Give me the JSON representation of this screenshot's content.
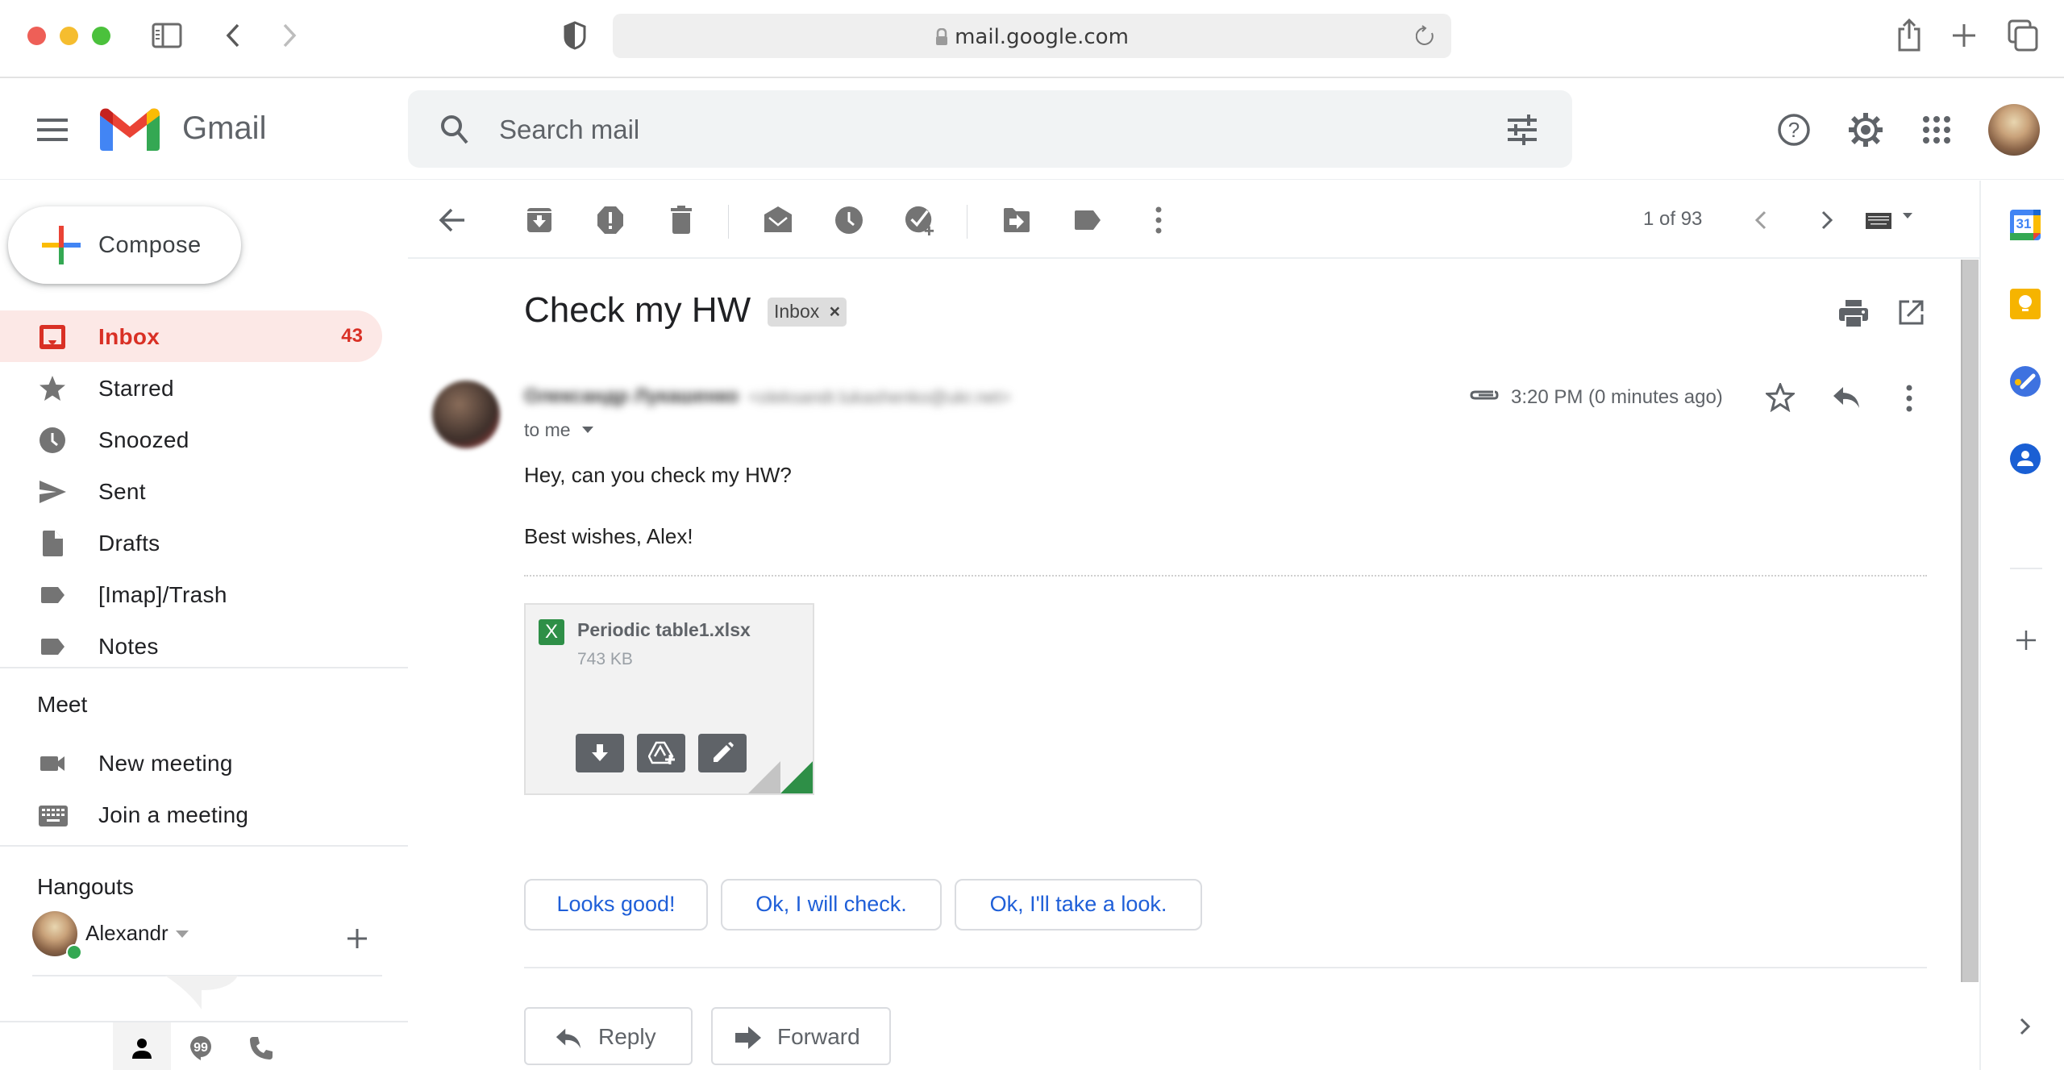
{
  "browser": {
    "url": "mail.google.com",
    "icons": [
      "sidebar-toggle-icon",
      "back-icon",
      "forward-icon",
      "privacy-shield-icon",
      "lock-icon",
      "reload-icon",
      "share-icon",
      "new-tab-icon",
      "tab-overview-icon"
    ]
  },
  "header": {
    "app_name": "Gmail",
    "search_placeholder": "Search mail",
    "icons": [
      "main-menu-icon",
      "search-icon",
      "search-options-icon",
      "help-icon",
      "settings-icon",
      "apps-grid-icon",
      "account-avatar"
    ]
  },
  "sidebar": {
    "compose_label": "Compose",
    "items": [
      {
        "label": "Inbox",
        "count": "43",
        "icon": "inbox-icon",
        "active": true
      },
      {
        "label": "Starred",
        "icon": "star-icon"
      },
      {
        "label": "Snoozed",
        "icon": "clock-icon"
      },
      {
        "label": "Sent",
        "icon": "send-icon"
      },
      {
        "label": "Drafts",
        "icon": "draft-icon"
      },
      {
        "label": "[Imap]/Trash",
        "icon": "label-icon"
      },
      {
        "label": "Notes",
        "icon": "label-icon"
      }
    ],
    "meet": {
      "title": "Meet",
      "items": [
        {
          "label": "New meeting",
          "icon": "video-camera-icon"
        },
        {
          "label": "Join a meeting",
          "icon": "keyboard-icon"
        }
      ]
    },
    "hangouts": {
      "title": "Hangouts",
      "user_name": "Alexandr",
      "status_color": "#34a853",
      "tabs": [
        "contacts-icon",
        "hangouts-chat-icon",
        "phone-icon"
      ]
    }
  },
  "toolbar": {
    "pager": "1 of 93",
    "icons": [
      "back-arrow-icon",
      "archive-icon",
      "report-spam-icon",
      "delete-icon",
      "mark-unread-icon",
      "snooze-icon",
      "add-to-tasks-icon",
      "move-to-icon",
      "labels-icon",
      "more-icon",
      "newer-icon",
      "older-icon",
      "input-tools-icon"
    ]
  },
  "email": {
    "subject": "Check my HW",
    "label_chip": "Inbox",
    "sender_name": "Олександр Лукашенко",
    "sender_email": "<oleksandr.lukashenko@ukr.net>",
    "to": "to me",
    "timestamp": "3:20 PM (0 minutes ago)",
    "body": [
      "Hey, can you check my HW?",
      "Best wishes, Alex!"
    ],
    "attachment": {
      "name": "Periodic table1.xlsx",
      "size": "743 KB",
      "type_letter": "X",
      "type_color": "#2e8f47"
    },
    "smart_replies": [
      "Looks good!",
      "Ok, I will check.",
      "Ok, I'll take a look."
    ],
    "actions": {
      "reply": "Reply",
      "forward": "Forward"
    }
  },
  "right_panel": {
    "apps": [
      "calendar-icon",
      "keep-icon",
      "tasks-icon",
      "contacts-icon"
    ],
    "calendar_day": "31"
  },
  "colors": {
    "accent_red": "#d93025",
    "inbox_active_bg": "#fce8e6",
    "link_blue": "#1f5fd8"
  }
}
